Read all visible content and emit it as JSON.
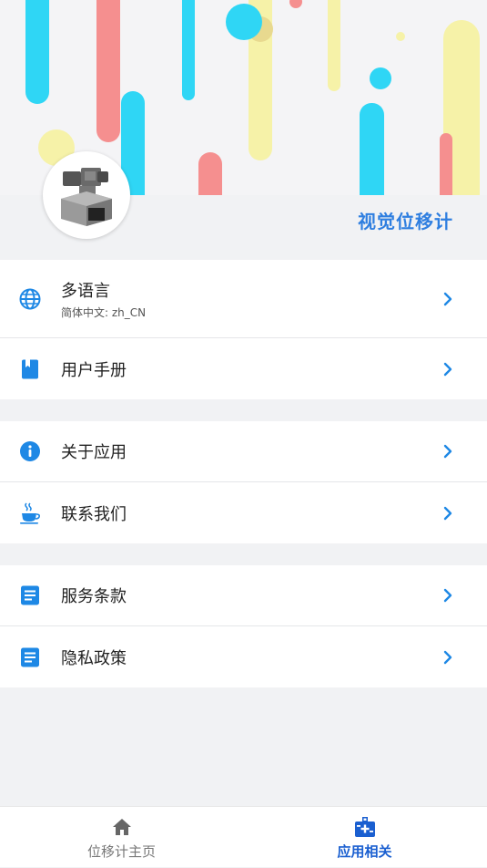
{
  "header": {
    "app_name": "视觉位移计"
  },
  "menu_groups": [
    {
      "items": [
        {
          "label": "多语言",
          "sublabel": "简体中文: zh_CN",
          "icon": "globe-icon"
        },
        {
          "label": "用户手册",
          "icon": "book-icon"
        }
      ]
    },
    {
      "items": [
        {
          "label": "关于应用",
          "icon": "info-icon"
        },
        {
          "label": "联系我们",
          "icon": "coffee-icon"
        }
      ]
    },
    {
      "items": [
        {
          "label": "服务条款",
          "icon": "document-icon"
        },
        {
          "label": "隐私政策",
          "icon": "document-icon"
        }
      ]
    }
  ],
  "tabbar": {
    "home_label": "位移计主页",
    "app_label": "应用相关",
    "active": "app"
  },
  "colors": {
    "accent": "#2f7fe0",
    "icon_blue": "#1e88e5",
    "active_tab": "#1a5fd0",
    "background": "#f1f2f4"
  }
}
